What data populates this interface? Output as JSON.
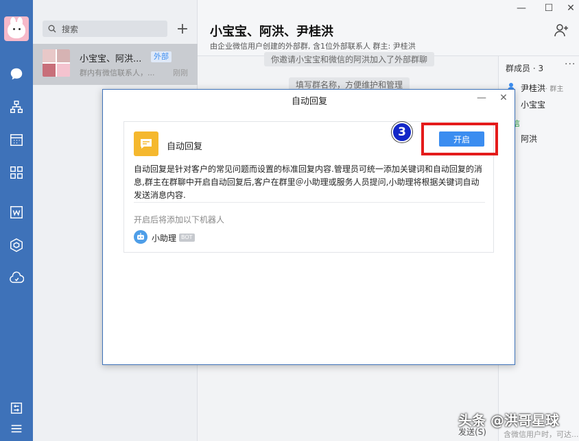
{
  "search": {
    "placeholder": "搜索"
  },
  "conversation": {
    "name": "小宝宝、阿洪...",
    "tag": "外部",
    "preview": "群内有微信联系人，...",
    "time": "刚刚"
  },
  "chat": {
    "title": "小宝宝、阿洪、尹桂洪",
    "subtitle": "由企业微信用户创建的外部群, 含1位外部联系人 群主: 尹桂洪",
    "sys_msg_1": "你邀请小宝宝和微信的阿洪加入了外部群聊",
    "sys_msg_2": "填写群名称，方便维护和管理",
    "send_hint": "发送(S)",
    "bottom_hint": "含微信用户时，可达..."
  },
  "members": {
    "title": "群成员 · 3",
    "more": "···",
    "list": [
      {
        "name": "尹桂洪",
        "role": "· 群主"
      },
      {
        "name": "小宝宝",
        "role": ""
      },
      {
        "name": "阿洪",
        "role": ""
      }
    ],
    "section_label": "信"
  },
  "dialog": {
    "title": "自动回复",
    "card_title": "自动回复",
    "description": "自动回复是针对客户的常见问题而设置的标准回复内容.管理员可统一添加关键词和自动回复的消息,群主在群聊中开启自动回复后,客户在群里＠小助理或服务人员提问,小助理将根据关键词自动发送消息内容.",
    "note": "开启后将添加以下机器人",
    "bot_name": "小助理",
    "bot_tag": "BOT",
    "open_label": "开启",
    "step_number": "3"
  },
  "watermark": "头条 @洪哥星球",
  "colors": {
    "nav": "#3e72b9",
    "accent": "#3b8df0",
    "highlight": "#e41b1b",
    "badge": "#1428c8"
  }
}
